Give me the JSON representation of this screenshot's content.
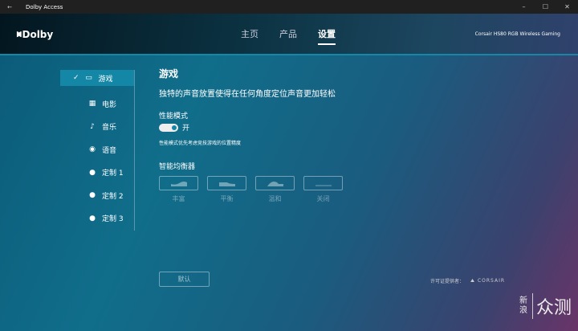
{
  "window": {
    "title": "Dolby Access",
    "back": "←",
    "minimize": "–",
    "maximize": "☐",
    "close": "✕"
  },
  "header": {
    "logo": "Dolby",
    "nav": [
      "主页",
      "产品",
      "设置"
    ],
    "active_nav": "设置",
    "device": "Corsair HS80 RGB Wireless Gaming"
  },
  "sidebar": {
    "items": [
      {
        "label": "游戏",
        "icon": "gamepad-icon",
        "glyph": "▭"
      },
      {
        "label": "电影",
        "icon": "film-icon",
        "glyph": "▦"
      },
      {
        "label": "音乐",
        "icon": "music-note-icon",
        "glyph": "♪"
      },
      {
        "label": "语音",
        "icon": "voice-icon",
        "glyph": "◉"
      },
      {
        "label": "定制 1",
        "icon": "user-icon",
        "glyph": "●"
      },
      {
        "label": "定制 2",
        "icon": "user-icon",
        "glyph": "●"
      },
      {
        "label": "定制 3",
        "icon": "user-icon",
        "glyph": "●"
      }
    ]
  },
  "content": {
    "title": "游戏",
    "description": "独特的声音放置使得在任何角度定位声音更加轻松",
    "perf_label": "性能模式",
    "perf_state": "开",
    "perf_note": "性能模式优先考虑竞技游戏的位置精度",
    "eq_label": "智能均衡器",
    "eq_presets": [
      "丰富",
      "平衡",
      "温和",
      "关闭"
    ],
    "default_button": "默认"
  },
  "footer": {
    "license_label": "许可证提供者：",
    "brand": "CORSAIR",
    "watermark_a": "新浪",
    "watermark_b": "众测"
  }
}
